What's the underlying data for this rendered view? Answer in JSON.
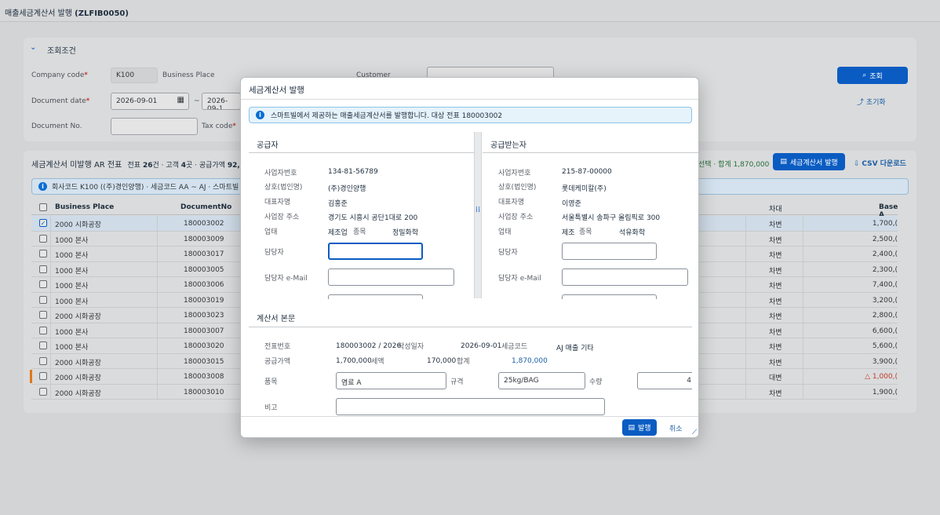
{
  "page": {
    "title_prefix": "매출세금계산서 발행 ",
    "title_code": "(ZLFIB0050)"
  },
  "filter": {
    "section_title": "조회조건",
    "company_code_label": "Company code",
    "company_code_value": "K100",
    "business_place_label": "Business Place",
    "customer_label": "Customer",
    "document_date_label": "Document date",
    "date_from": "2026-09-01",
    "date_to": "2026-09-1",
    "document_no_label": "Document No.",
    "tax_code_label": "Tax code",
    "search_button": "조회",
    "reset_button": "초기화",
    "required_mark": "*",
    "tilde": "~"
  },
  "list": {
    "title_main": "세금계산서 미발행 AR 전표",
    "summary_a": "전표 ",
    "summary_docs": "26",
    "summary_b": "건 · 고객 ",
    "summary_customers": "4",
    "summary_c": "곳 · 공급가액 ",
    "summary_amount": "92,",
    "selected_summary": "선택 · 합계 1,870,000",
    "issue_button": "세금계산서 발행",
    "csv_button": "CSV 다운로드",
    "info_text": "회사코드 K100 ((주)경인양행) · 세금코드 AA ~ AJ · 스마트빌",
    "columns": {
      "business_place": "Business Place",
      "document_no": "DocumentNo",
      "debit_credit": "차대",
      "base_amount": "Base A"
    },
    "rows": [
      {
        "place": "2000 시화공장",
        "doc": "180003002",
        "dc": "차변",
        "amt": "1,700,(",
        "selected": true
      },
      {
        "place": "1000 본사",
        "doc": "180003009",
        "dc": "차변",
        "amt": "2,500,("
      },
      {
        "place": "1000 본사",
        "doc": "180003017",
        "dc": "차변",
        "amt": "2,400,("
      },
      {
        "place": "1000 본사",
        "doc": "180003005",
        "dc": "차변",
        "amt": "2,300,("
      },
      {
        "place": "1000 본사",
        "doc": "180003006",
        "dc": "차변",
        "amt": "7,400,("
      },
      {
        "place": "1000 본사",
        "doc": "180003019",
        "dc": "차변",
        "amt": "3,200,("
      },
      {
        "place": "2000 시화공장",
        "doc": "180003023",
        "dc": "차변",
        "amt": "2,800,("
      },
      {
        "place": "1000 본사",
        "doc": "180003007",
        "dc": "차변",
        "amt": "6,600,("
      },
      {
        "place": "1000 본사",
        "doc": "180003020",
        "dc": "차변",
        "amt": "5,600,("
      },
      {
        "place": "2000 시화공장",
        "doc": "180003015",
        "dc": "차변",
        "amt": "3,900,("
      },
      {
        "place": "2000 시화공장",
        "doc": "180003008",
        "dc": "대변",
        "amt": "△ 1,000,(",
        "negative": true,
        "flag": true
      },
      {
        "place": "2000 시화공장",
        "doc": "180003010",
        "dc": "차변",
        "amt": "1,900,("
      }
    ]
  },
  "dialog": {
    "title": "세금계산서 발행",
    "info": "스마트빌에서 제공하는 매출세금계산서를 발행합니다. 대상 전표 180003002",
    "supplier": {
      "heading": "공급자",
      "biz_no_label": "사업자번호",
      "biz_no": "134-81-56789",
      "company_label": "상호(법인명)",
      "company": "(주)경인양행",
      "ceo_label": "대표자명",
      "ceo": "김홍준",
      "address_label": "사업장 주소",
      "address": "경기도 시흥시 공단1대로 200",
      "type_label": "업태",
      "type": "제조업",
      "item_label": "종목",
      "item": "정밀화학",
      "manager_label": "담당자",
      "email_label": "담당자 e-Mail"
    },
    "buyer": {
      "heading": "공급받는자",
      "biz_no_label": "사업자번호",
      "biz_no": "215-87-00000",
      "company_label": "상호(법인명)",
      "company": "롯데케미칼(주)",
      "ceo_label": "대표자명",
      "ceo": "이영준",
      "address_label": "사업장 주소",
      "address": "서울특별시 송파구 올림픽로 300",
      "type_label": "업태",
      "type": "제조",
      "item_label": "종목",
      "item": "석유화학",
      "manager_label": "담당자",
      "email_label": "담당자 e-Mail"
    },
    "body": {
      "heading": "계산서 본문",
      "doc_no_label": "전표번호",
      "doc_no": "180003002 / 2026",
      "write_date_label": "작성일자",
      "write_date": "2026-09-01",
      "tax_code_label": "세금코드",
      "tax_code": "AJ 매출 기타",
      "supply_label": "공급가액",
      "supply": "1,700,000",
      "vat_label": "세액",
      "vat": "170,000",
      "total_label": "합계",
      "total": "1,870,000",
      "item_label": "품목",
      "item_value": "염료 A",
      "spec_label": "규격",
      "spec_value": "25kg/BAG",
      "qty_label": "수량",
      "qty_value": "4",
      "note_label": "비고"
    },
    "issue_button": "발행",
    "cancel_button": "취소"
  },
  "colors": {
    "accent": "#0a5cc2",
    "negative": "#c0392b",
    "link": "#1b5fa8"
  }
}
